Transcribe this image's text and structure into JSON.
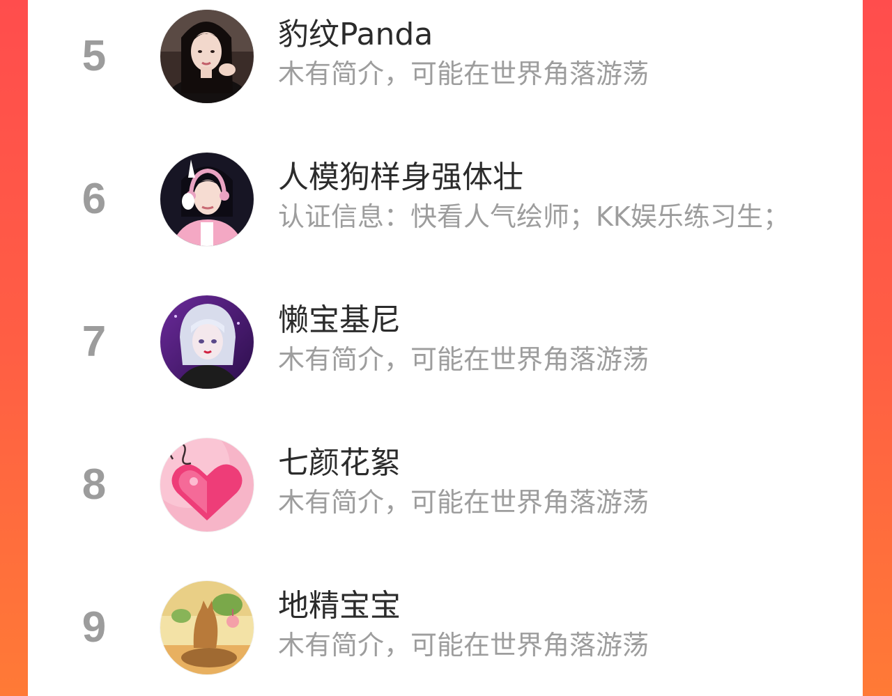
{
  "ranking": {
    "items": [
      {
        "rank": "5",
        "name": "豹纹Panda",
        "desc": "木有简介，可能在世界角落游荡",
        "avatar_icon": "woman-portrait-avatar"
      },
      {
        "rank": "6",
        "name": "人模狗样身强体壮",
        "desc": "认证信息：快看人气绘师；KK娱乐练习生；",
        "avatar_icon": "girl-headphones-avatar"
      },
      {
        "rank": "7",
        "name": "懒宝基尼",
        "desc": "木有简介，可能在世界角落游荡",
        "avatar_icon": "silver-hair-illustration-avatar"
      },
      {
        "rank": "8",
        "name": "七颜花絮",
        "desc": "木有简介，可能在世界角落游荡",
        "avatar_icon": "pink-heart-avatar"
      },
      {
        "rank": "9",
        "name": "地精宝宝",
        "desc": "木有简介，可能在世界角落游荡",
        "avatar_icon": "cat-illustration-avatar"
      }
    ]
  },
  "colors": {
    "background_top": "#ff4d4d",
    "background_bottom": "#ff7a36",
    "rank_gray": "#9c9c9c",
    "name_text": "#2b2b2b",
    "desc_text": "#9d9d9d"
  }
}
